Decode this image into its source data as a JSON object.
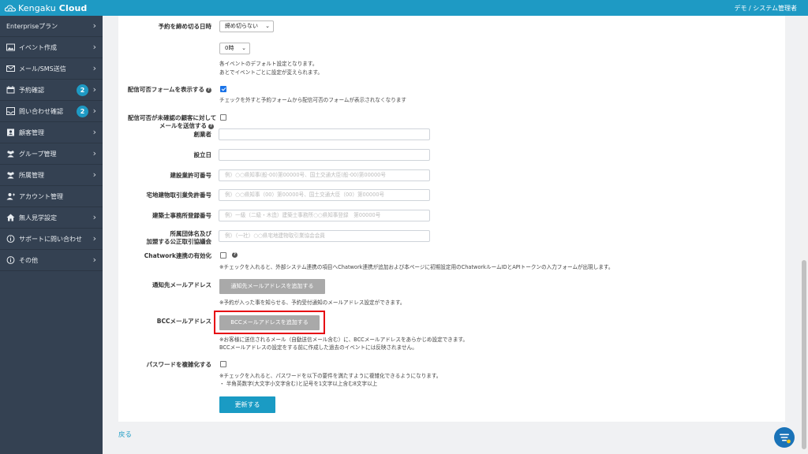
{
  "app": {
    "logo_main": "Kengaku",
    "logo_sub": "Cloud",
    "user": "デモ / システム管理者"
  },
  "sidebar": {
    "items": [
      {
        "label": "Enterpriseプラン"
      },
      {
        "label": "イベント作成"
      },
      {
        "label": "メール/SMS送信"
      },
      {
        "label": "予約確認",
        "badge": "2"
      },
      {
        "label": "問い合わせ確認",
        "badge": "2"
      },
      {
        "label": "顧客管理"
      },
      {
        "label": "グループ管理"
      },
      {
        "label": "所属管理"
      },
      {
        "label": "アカウント管理"
      },
      {
        "label": "無人見学設定"
      },
      {
        "label": "サポートに問い合わせ"
      },
      {
        "label": "その他"
      }
    ]
  },
  "form": {
    "deadline": {
      "label": "予約を締め切る日時",
      "select_value": "締め切らない",
      "hour_value": "0時",
      "note1": "各イベントのデフォルト設定となります。",
      "note2": "あとでイベントごとに設定が変えられます。"
    },
    "show_optout": {
      "label": "配信可否フォームを表示する",
      "checked": true,
      "note": "チェックを外すと予約フォームから配信可否のフォームが表示されなくなります"
    },
    "unconfirmed": {
      "label_line1": "配信可否が未確認の顧客に対して",
      "label_line2": "メールを送信する",
      "checked": false
    },
    "founder": {
      "label": "創業者",
      "value": ""
    },
    "established": {
      "label": "設立日",
      "value": ""
    },
    "construction_license": {
      "label": "建設業許可番号",
      "placeholder": "例）○○県知事(般-00)第00000号、国土交通大臣(般-00)第00000号"
    },
    "realestate_license": {
      "label": "宅地建物取引業免許番号",
      "placeholder": "例）○○県知事（00）第00000号、国土交通大臣（00）第00000号"
    },
    "architect_office": {
      "label": "建築士事務所登録番号",
      "placeholder": "例）一級（二級・木造）建築士事務所○○県知事登録　第00000号"
    },
    "association": {
      "label_line1": "所属団体名及び",
      "label_line2": "加盟する公正取引協議会",
      "placeholder": "例）（一社）○○県宅地建物取引業協会会員"
    },
    "chatwork": {
      "label": "Chatwork連携の有効化",
      "checked": false,
      "note": "※チェックを入れると、外部システム連携の項目へChatwork連携が追加および本ページに初期設定用のChatworkルームIDとAPIトークンの入力フォームが出現します。"
    },
    "notify_email": {
      "label": "通知先メールアドレス",
      "button": "通知先メールアドレスを追加する",
      "note": "※予約が入った事を知らせる、予約受付通知のメールアドレス設定ができます。"
    },
    "bcc_email": {
      "label": "BCCメールアドレス",
      "button": "BCCメールアドレスを追加する",
      "note1": "※お客様に送信されるメール（自動送信メール含む）に、BCCメールアドレスをあらかじめ設定できます。",
      "note2": "BCCメールアドレスの設定をする前に作成した過去のイベントには反映されません。"
    },
    "password": {
      "label": "パスワードを複雑化する",
      "checked": false,
      "note1": "※チェックを入れると、パスワードを以下の要件を満たすように複雑化できるようになります。",
      "note2": "・ 半角英数字(大文字小文字含む)と記号を1文字以上含む8文字以上"
    },
    "submit": "更新する"
  },
  "footer": {
    "back": "戻る"
  },
  "colors": {
    "header": "#1e9ac4",
    "sidebar": "#344152",
    "accent": "#1a9bc4",
    "highlight": "#e60012"
  }
}
